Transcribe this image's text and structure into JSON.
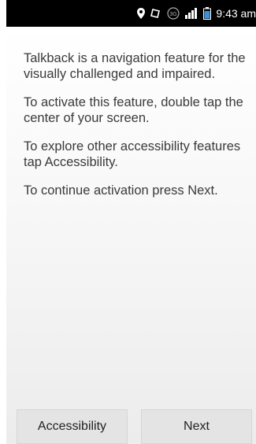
{
  "status_bar": {
    "time": "9:43 am",
    "icons": [
      "location-pin-icon",
      "alarm-icon",
      "data-3g-icon",
      "signal-icon",
      "battery-icon"
    ]
  },
  "content": {
    "paragraphs": [
      "Talkback is a navigation feature for the visually challenged and impaired.",
      "To activate this feature, double tap the center of your screen.",
      "To explore other accessibility features tap Accessibility.",
      "To continue activation press Next."
    ]
  },
  "buttons": {
    "accessibility_label": "Accessibility",
    "next_label": "Next"
  }
}
